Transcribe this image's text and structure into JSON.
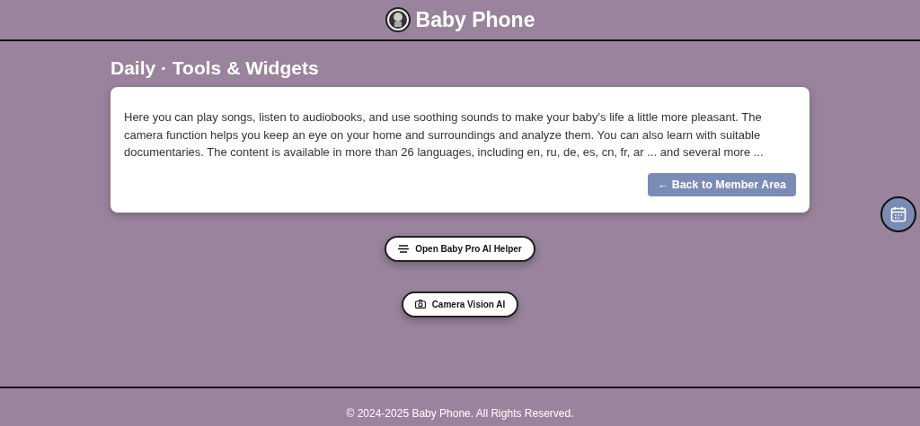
{
  "header": {
    "title": "Baby Phone"
  },
  "page_title": "Daily · Tools & Widgets",
  "intro": {
    "text": "Here you can play songs, listen to audiobooks, and use soothing sounds to make your baby's life a little more pleasant. The camera function helps you keep an eye on your home and surroundings and analyze them. You can also learn with suitable documentaries. The content is available in more than 26 languages, including en, ru, de, es, cn, fr, ar ... and several more ...",
    "button": "← Back to Member Area"
  },
  "actions": [
    {
      "label": "Open Baby Pro AI Helper",
      "kind": "helper"
    },
    {
      "label": "Camera Vision AI",
      "kind": "camera"
    }
  ],
  "footer": "© 2024-2025 Baby Phone. All Rights Reserved."
}
